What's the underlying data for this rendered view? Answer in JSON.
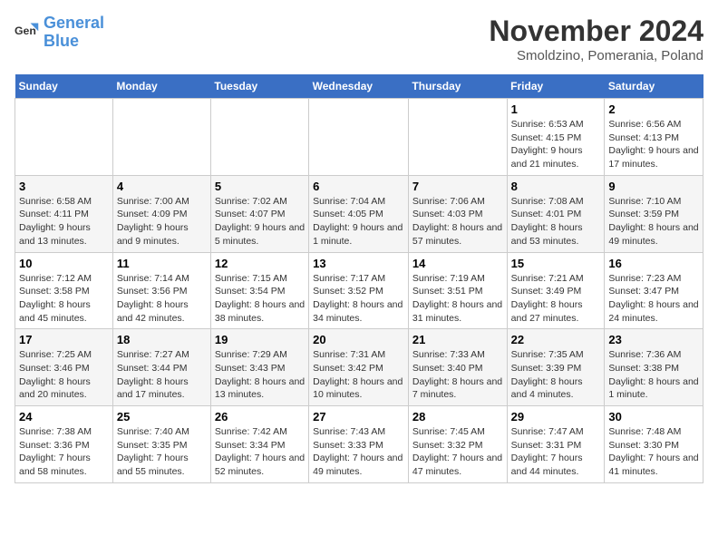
{
  "logo": {
    "line1": "General",
    "line2": "Blue"
  },
  "title": "November 2024",
  "location": "Smoldzino, Pomerania, Poland",
  "days_of_week": [
    "Sunday",
    "Monday",
    "Tuesday",
    "Wednesday",
    "Thursday",
    "Friday",
    "Saturday"
  ],
  "weeks": [
    [
      {
        "day": "",
        "info": ""
      },
      {
        "day": "",
        "info": ""
      },
      {
        "day": "",
        "info": ""
      },
      {
        "day": "",
        "info": ""
      },
      {
        "day": "",
        "info": ""
      },
      {
        "day": "1",
        "info": "Sunrise: 6:53 AM\nSunset: 4:15 PM\nDaylight: 9 hours and 21 minutes."
      },
      {
        "day": "2",
        "info": "Sunrise: 6:56 AM\nSunset: 4:13 PM\nDaylight: 9 hours and 17 minutes."
      }
    ],
    [
      {
        "day": "3",
        "info": "Sunrise: 6:58 AM\nSunset: 4:11 PM\nDaylight: 9 hours and 13 minutes."
      },
      {
        "day": "4",
        "info": "Sunrise: 7:00 AM\nSunset: 4:09 PM\nDaylight: 9 hours and 9 minutes."
      },
      {
        "day": "5",
        "info": "Sunrise: 7:02 AM\nSunset: 4:07 PM\nDaylight: 9 hours and 5 minutes."
      },
      {
        "day": "6",
        "info": "Sunrise: 7:04 AM\nSunset: 4:05 PM\nDaylight: 9 hours and 1 minute."
      },
      {
        "day": "7",
        "info": "Sunrise: 7:06 AM\nSunset: 4:03 PM\nDaylight: 8 hours and 57 minutes."
      },
      {
        "day": "8",
        "info": "Sunrise: 7:08 AM\nSunset: 4:01 PM\nDaylight: 8 hours and 53 minutes."
      },
      {
        "day": "9",
        "info": "Sunrise: 7:10 AM\nSunset: 3:59 PM\nDaylight: 8 hours and 49 minutes."
      }
    ],
    [
      {
        "day": "10",
        "info": "Sunrise: 7:12 AM\nSunset: 3:58 PM\nDaylight: 8 hours and 45 minutes."
      },
      {
        "day": "11",
        "info": "Sunrise: 7:14 AM\nSunset: 3:56 PM\nDaylight: 8 hours and 42 minutes."
      },
      {
        "day": "12",
        "info": "Sunrise: 7:15 AM\nSunset: 3:54 PM\nDaylight: 8 hours and 38 minutes."
      },
      {
        "day": "13",
        "info": "Sunrise: 7:17 AM\nSunset: 3:52 PM\nDaylight: 8 hours and 34 minutes."
      },
      {
        "day": "14",
        "info": "Sunrise: 7:19 AM\nSunset: 3:51 PM\nDaylight: 8 hours and 31 minutes."
      },
      {
        "day": "15",
        "info": "Sunrise: 7:21 AM\nSunset: 3:49 PM\nDaylight: 8 hours and 27 minutes."
      },
      {
        "day": "16",
        "info": "Sunrise: 7:23 AM\nSunset: 3:47 PM\nDaylight: 8 hours and 24 minutes."
      }
    ],
    [
      {
        "day": "17",
        "info": "Sunrise: 7:25 AM\nSunset: 3:46 PM\nDaylight: 8 hours and 20 minutes."
      },
      {
        "day": "18",
        "info": "Sunrise: 7:27 AM\nSunset: 3:44 PM\nDaylight: 8 hours and 17 minutes."
      },
      {
        "day": "19",
        "info": "Sunrise: 7:29 AM\nSunset: 3:43 PM\nDaylight: 8 hours and 13 minutes."
      },
      {
        "day": "20",
        "info": "Sunrise: 7:31 AM\nSunset: 3:42 PM\nDaylight: 8 hours and 10 minutes."
      },
      {
        "day": "21",
        "info": "Sunrise: 7:33 AM\nSunset: 3:40 PM\nDaylight: 8 hours and 7 minutes."
      },
      {
        "day": "22",
        "info": "Sunrise: 7:35 AM\nSunset: 3:39 PM\nDaylight: 8 hours and 4 minutes."
      },
      {
        "day": "23",
        "info": "Sunrise: 7:36 AM\nSunset: 3:38 PM\nDaylight: 8 hours and 1 minute."
      }
    ],
    [
      {
        "day": "24",
        "info": "Sunrise: 7:38 AM\nSunset: 3:36 PM\nDaylight: 7 hours and 58 minutes."
      },
      {
        "day": "25",
        "info": "Sunrise: 7:40 AM\nSunset: 3:35 PM\nDaylight: 7 hours and 55 minutes."
      },
      {
        "day": "26",
        "info": "Sunrise: 7:42 AM\nSunset: 3:34 PM\nDaylight: 7 hours and 52 minutes."
      },
      {
        "day": "27",
        "info": "Sunrise: 7:43 AM\nSunset: 3:33 PM\nDaylight: 7 hours and 49 minutes."
      },
      {
        "day": "28",
        "info": "Sunrise: 7:45 AM\nSunset: 3:32 PM\nDaylight: 7 hours and 47 minutes."
      },
      {
        "day": "29",
        "info": "Sunrise: 7:47 AM\nSunset: 3:31 PM\nDaylight: 7 hours and 44 minutes."
      },
      {
        "day": "30",
        "info": "Sunrise: 7:48 AM\nSunset: 3:30 PM\nDaylight: 7 hours and 41 minutes."
      }
    ]
  ]
}
